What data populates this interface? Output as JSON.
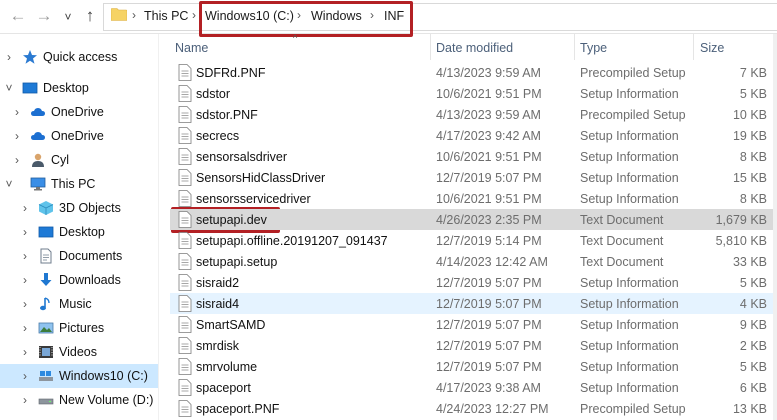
{
  "address": {
    "crumbs": [
      "This PC",
      "Windows10 (C:)",
      "Windows",
      "INF"
    ],
    "separator": "›"
  },
  "nav_buttons": {
    "back": "←",
    "forward": "→",
    "recent": "˅",
    "up": "↑"
  },
  "sidebar": {
    "items": [
      {
        "label": "Quick access",
        "icon": "star-icon"
      },
      {
        "label": "Desktop",
        "icon": "desktop-icon"
      },
      {
        "label": "OneDrive",
        "icon": "cloud-icon"
      },
      {
        "label": "OneDrive",
        "icon": "cloud-icon"
      },
      {
        "label": "Cyl",
        "icon": "user-icon"
      },
      {
        "label": "This PC",
        "icon": "computer-icon"
      },
      {
        "label": "3D Objects",
        "icon": "cube-icon"
      },
      {
        "label": "Desktop",
        "icon": "desktop-icon"
      },
      {
        "label": "Documents",
        "icon": "document-icon"
      },
      {
        "label": "Downloads",
        "icon": "download-icon"
      },
      {
        "label": "Music",
        "icon": "music-icon"
      },
      {
        "label": "Pictures",
        "icon": "picture-icon"
      },
      {
        "label": "Videos",
        "icon": "video-icon"
      },
      {
        "label": "Windows10 (C:)",
        "icon": "drive-icon"
      },
      {
        "label": "New Volume (D:)",
        "icon": "drive-icon"
      }
    ]
  },
  "columns": {
    "name": "Name",
    "date": "Date modified",
    "type": "Type",
    "size": "Size"
  },
  "files": [
    {
      "name": "SDFRd.PNF",
      "date": "4/13/2023 9:59 AM",
      "type": "Precompiled Setup Information",
      "size": "7 KB"
    },
    {
      "name": "sdstor",
      "date": "10/6/2021 9:51 PM",
      "type": "Setup Information",
      "size": "5 KB"
    },
    {
      "name": "sdstor.PNF",
      "date": "4/13/2023 9:59 AM",
      "type": "Precompiled Setup Information",
      "size": "10 KB"
    },
    {
      "name": "secrecs",
      "date": "4/17/2023 9:42 AM",
      "type": "Setup Information",
      "size": "19 KB"
    },
    {
      "name": "sensorsalsdriver",
      "date": "10/6/2021 9:51 PM",
      "type": "Setup Information",
      "size": "8 KB"
    },
    {
      "name": "SensorsHidClassDriver",
      "date": "12/7/2019 5:07 PM",
      "type": "Setup Information",
      "size": "15 KB"
    },
    {
      "name": "sensorsservicedriver",
      "date": "10/6/2021 9:51 PM",
      "type": "Setup Information",
      "size": "8 KB"
    },
    {
      "name": "setupapi.dev",
      "date": "4/26/2023 2:35 PM",
      "type": "Text Document",
      "size": "1,679 KB"
    },
    {
      "name": "setupapi.offline.20191207_091437",
      "date": "12/7/2019 5:14 PM",
      "type": "Text Document",
      "size": "5,810 KB"
    },
    {
      "name": "setupapi.setup",
      "date": "4/14/2023 12:42 AM",
      "type": "Text Document",
      "size": "33 KB"
    },
    {
      "name": "sisraid2",
      "date": "12/7/2019 5:07 PM",
      "type": "Setup Information",
      "size": "5 KB"
    },
    {
      "name": "sisraid4",
      "date": "12/7/2019 5:07 PM",
      "type": "Setup Information",
      "size": "4 KB"
    },
    {
      "name": "SmartSAMD",
      "date": "12/7/2019 5:07 PM",
      "type": "Setup Information",
      "size": "9 KB"
    },
    {
      "name": "smrdisk",
      "date": "12/7/2019 5:07 PM",
      "type": "Setup Information",
      "size": "2 KB"
    },
    {
      "name": "smrvolume",
      "date": "12/7/2019 5:07 PM",
      "type": "Setup Information",
      "size": "5 KB"
    },
    {
      "name": "spaceport",
      "date": "4/17/2023 9:38 AM",
      "type": "Setup Information",
      "size": "6 KB"
    },
    {
      "name": "spaceport.PNF",
      "date": "4/24/2023 12:27 PM",
      "type": "Precompiled Setup Information",
      "size": "13 KB"
    }
  ],
  "colors": {
    "accent_selection": "#cce8ff",
    "row_selected": "#d9d9d9",
    "row_hover": "#e5f3ff",
    "annotation_red": "#b32024"
  }
}
